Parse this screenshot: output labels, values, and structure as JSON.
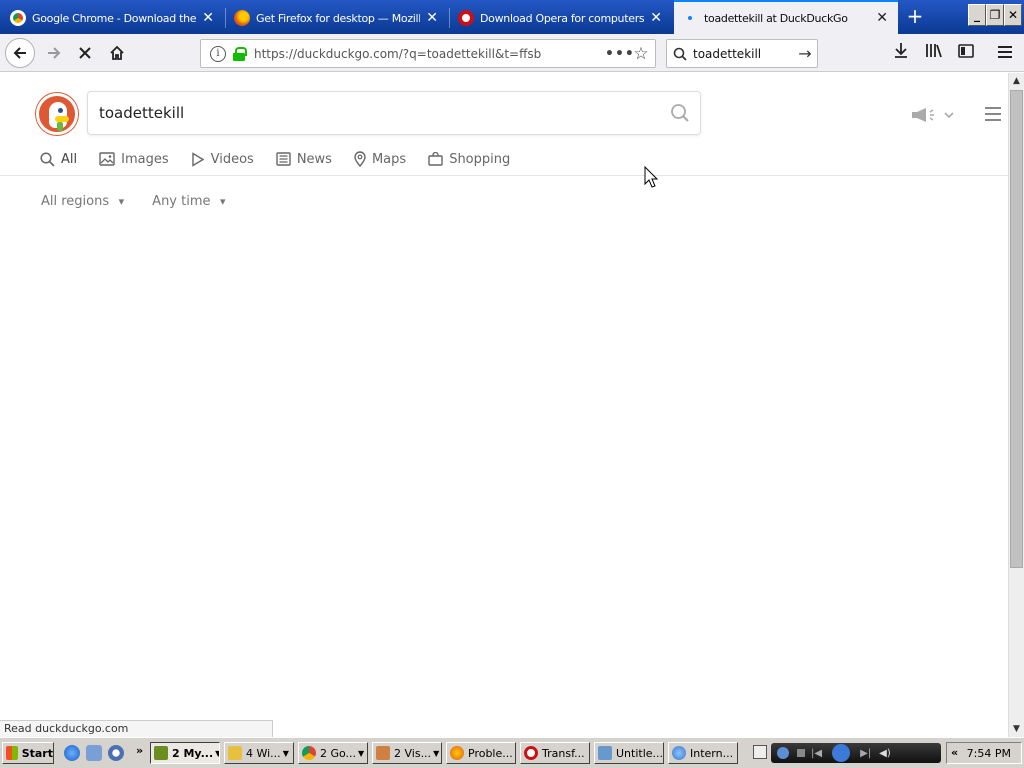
{
  "browser": {
    "tabs": [
      {
        "title": "Google Chrome - Download the Fa",
        "favicon_color": "#e44"
      },
      {
        "title": "Get Firefox for desktop — Mozilla",
        "favicon_color": "#e66000"
      },
      {
        "title": "Download Opera for computers - (",
        "favicon_color": "#cc0f16"
      },
      {
        "title": "toadettekill at DuckDuckGo",
        "favicon_color": "#0a84ff"
      }
    ],
    "url": "https://duckduckgo.com/?q=toadettekill&t=ffsb",
    "search_value": "toadettekill"
  },
  "ddg": {
    "query": "toadettekill",
    "verticals": [
      "All",
      "Images",
      "Videos",
      "News",
      "Maps",
      "Shopping"
    ],
    "filters": [
      "All regions",
      "Any time"
    ]
  },
  "status_text": "Read duckduckgo.com",
  "taskbar": {
    "start_label": "Start",
    "tasks": [
      {
        "label": "2 My...",
        "color": "#6b8e23",
        "dropdown": true
      },
      {
        "label": "4 Wi...",
        "color": "#e8c040",
        "dropdown": true
      },
      {
        "label": "2 Go...",
        "color": "#dd4433",
        "dropdown": true
      },
      {
        "label": "2 Vis...",
        "color": "#d08040",
        "dropdown": true
      },
      {
        "label": "Proble...",
        "color": "#e05a20",
        "dropdown": false
      },
      {
        "label": "Transf...",
        "color": "#cc1111",
        "dropdown": false
      },
      {
        "label": "Untitle...",
        "color": "#6699cc",
        "dropdown": false
      },
      {
        "label": "Intern...",
        "color": "#3a78c8",
        "dropdown": false
      }
    ],
    "clock": "7:54 PM",
    "overflow_label": "«"
  },
  "colors": {
    "tabstrip": "#0a3a93",
    "accent": "#0a84ff",
    "ddg_orange": "#de5833",
    "lock_green": "#12bc00"
  }
}
